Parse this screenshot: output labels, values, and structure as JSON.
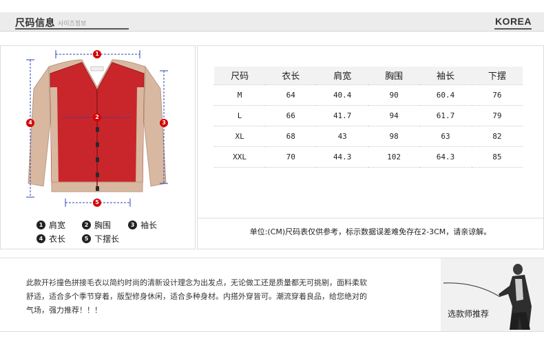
{
  "header": {
    "title": "尺码信息",
    "subtitle": "사이즈정보",
    "brand": "KOREA"
  },
  "diagram": {
    "markers": [
      "1",
      "2",
      "3",
      "4",
      "5"
    ]
  },
  "legend": [
    {
      "num": "1",
      "label": "肩宽"
    },
    {
      "num": "2",
      "label": "胸围"
    },
    {
      "num": "3",
      "label": "袖长"
    },
    {
      "num": "4",
      "label": "衣长"
    },
    {
      "num": "5",
      "label": "下摆长"
    }
  ],
  "size_table": {
    "headers": [
      "尺码",
      "衣长",
      "肩宽",
      "胸围",
      "袖长",
      "下摆"
    ],
    "rows": [
      [
        "M",
        "64",
        "40.4",
        "90",
        "60.4",
        "76"
      ],
      [
        "L",
        "66",
        "41.7",
        "94",
        "61.7",
        "79"
      ],
      [
        "XL",
        "68",
        "43",
        "98",
        "63",
        "82"
      ],
      [
        "XXL",
        "70",
        "44.3",
        "102",
        "64.3",
        "85"
      ]
    ]
  },
  "note": "单位:(CM)尺码表仅供参考，标示数据误差难免存在2-3CM，请亲谅解。",
  "description": {
    "line1": "此款开衫撞色拼接毛衣以简约时尚的清新设计理念为出发点，无论做工还是质量都无可挑剔，面料柔软",
    "line2": "舒适，适合多个季节穿着，版型修身休闲，适合多种身材。内搭外穿皆可。潮流穿着良品，给您绝对的",
    "line3": "气场，强力推荐！！！"
  },
  "designer": {
    "label": "选款师推荐"
  },
  "colors": {
    "accent_red": "#d60000",
    "sweater_body": "#c9262b",
    "sweater_sleeve": "#d8b8a0",
    "dimension_line": "#2b3fb8"
  }
}
